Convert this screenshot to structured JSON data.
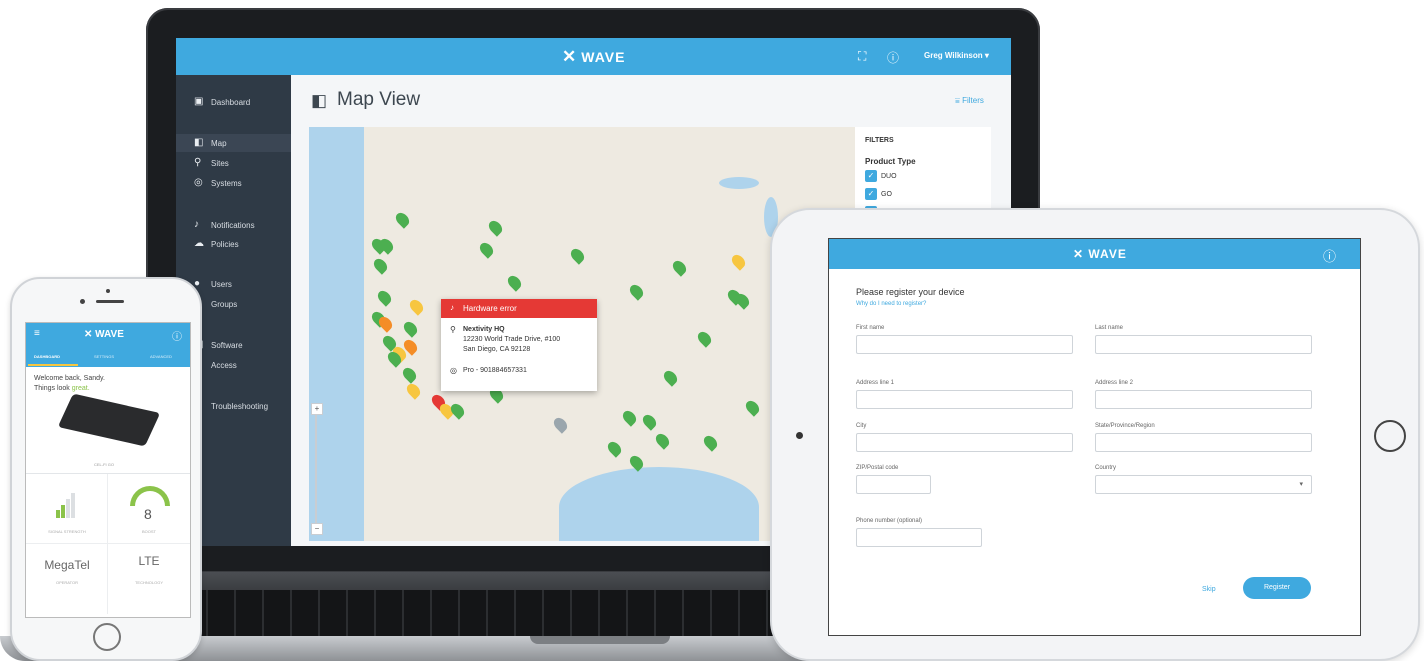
{
  "laptop": {
    "app_logo": "WAVE",
    "header_user": "Greg Wilkinson",
    "sidebar": [
      {
        "label": "Dashboard",
        "icon": "dashboard-icon",
        "glyph": "▣"
      },
      {
        "label": "Map",
        "icon": "map-icon",
        "glyph": "◧"
      },
      {
        "label": "Sites",
        "icon": "location-pin-icon",
        "glyph": "⚲"
      },
      {
        "label": "Systems",
        "icon": "systems-icon",
        "glyph": "◎"
      },
      {
        "label": "Notifications",
        "icon": "bell-icon",
        "glyph": "♪"
      },
      {
        "label": "Policies",
        "icon": "cloud-icon",
        "glyph": "☁"
      },
      {
        "label": "Users",
        "icon": "user-icon",
        "glyph": "●"
      },
      {
        "label": "Groups",
        "icon": "group-icon",
        "glyph": "●"
      },
      {
        "label": "Software",
        "icon": "software-icon",
        "glyph": "▤"
      },
      {
        "label": "Access",
        "icon": "key-icon",
        "glyph": "⚷"
      },
      {
        "label": "Troubleshooting",
        "icon": "wrench-icon",
        "glyph": "✎"
      }
    ],
    "page_title": "Map View",
    "filters_link": "Filters",
    "popup": {
      "title": "Hardware error",
      "site": "Nextivity HQ",
      "address_line1": "12230 World Trade Drive, #100",
      "address_line2": "San Diego, CA 92128",
      "device": "Pro - 901884657331"
    },
    "filter_panel": {
      "title": "FILTERS",
      "section": "Product Type",
      "options": [
        {
          "label": "DUO",
          "checked": true
        },
        {
          "label": "GO",
          "checked": true
        }
      ]
    },
    "zoom_in": "+",
    "zoom_out": "−",
    "colors": {
      "header": "#3fa9df",
      "sidebar": "#2f3a46",
      "error": "#e53935"
    }
  },
  "tablet": {
    "app_logo": "WAVE",
    "title": "Please register your device",
    "why_link": "Why do I need to register?",
    "fields": {
      "first_name": "First name",
      "last_name": "Last name",
      "address1": "Address line 1",
      "address2": "Address line 2",
      "city": "City",
      "state": "State/Province/Region",
      "zip": "ZIP/Postal code",
      "country": "Country",
      "phone": "Phone number (optional)"
    },
    "skip": "Skip",
    "register": "Register"
  },
  "phone": {
    "app_logo": "WAVE",
    "tabs": [
      "DASHBOARD",
      "SETTINGS",
      "ADVANCED"
    ],
    "welcome": "Welcome back, Sandy.",
    "status_prefix": "Things look",
    "status_word": "great.",
    "device_label": "CEL-FI GO",
    "signal_caption": "SIGNAL STRENGTH",
    "boost_value": "8",
    "boost_caption": "BOOST",
    "operator": "MegaTel",
    "operator_caption": "OPERATOR",
    "technology": "LTE",
    "technology_caption": "TECHNOLOGY"
  }
}
